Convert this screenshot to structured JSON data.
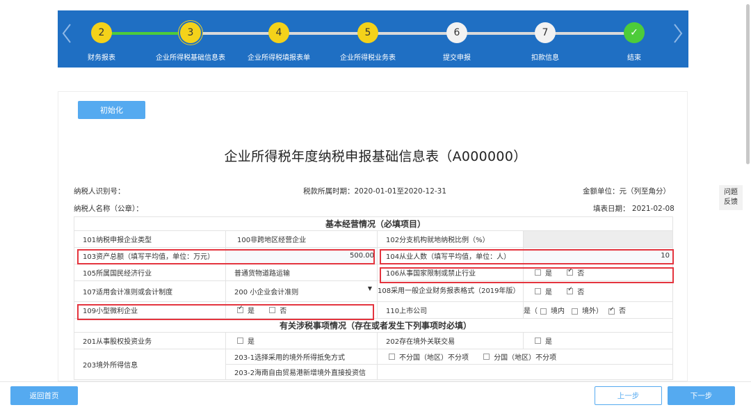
{
  "steps": [
    {
      "num": "2",
      "label": "财务报表"
    },
    {
      "num": "3",
      "label": "企业所得税基础信息表"
    },
    {
      "num": "4",
      "label": "企业所得税填报表单"
    },
    {
      "num": "5",
      "label": "企业所得税业务表"
    },
    {
      "num": "6",
      "label": "提交申报"
    },
    {
      "num": "7",
      "label": "扣款信息"
    },
    {
      "num": "✓",
      "label": "结束"
    }
  ],
  "init_button": "初始化",
  "form_title": "企业所得税年度纳税申报基础信息表（A000000）",
  "meta": {
    "taxpayer_id_label": "纳税人识别号：",
    "period": "税款所属时期：2020-01-01至2020-12-31",
    "unit": "金额单位：元（列至角分）",
    "taxpayer_name_label": "纳税人名称（公章）：",
    "fill_date": "填表日期： 2021-02-08"
  },
  "sections": {
    "basic": "基本经营情况（必填项目）",
    "tax_matters": "有关涉税事项情况（存在或者发生下列事项时必填）"
  },
  "rows": {
    "r101": {
      "label": "101纳税申报企业类型",
      "value": "100非跨地区经营企业"
    },
    "r102": {
      "label": "102分支机构就地纳税比例（%）"
    },
    "r103": {
      "label": "103资产总额（填写平均值，单位：万元）",
      "value": "500.00"
    },
    "r104": {
      "label": "104从业人数（填写平均值，单位：人）",
      "value": "10"
    },
    "r105": {
      "label": "105所属国民经济行业",
      "value": "普通货物道路运输"
    },
    "r106": {
      "label": "106从事国家限制或禁止行业"
    },
    "r107": {
      "label": "107适用会计准则或会计制度",
      "value": "200 小企业会计准则"
    },
    "r108": {
      "label": "108采用一般企业财务报表格式（2019年版）"
    },
    "r109": {
      "label": "109小型微利企业"
    },
    "r110": {
      "label": "110上市公司",
      "prefix": "是（",
      "domestic": "境内",
      "overseas": "境外）"
    },
    "r201": {
      "label": "201从事股权投资业务"
    },
    "r202": {
      "label": "202存在境外关联交易"
    },
    "r203": {
      "label": "203境外所得信息"
    },
    "r203_1": {
      "label": "203-1选择采用的境外所得抵免方式",
      "opt1": "不分国（地区）不分项",
      "opt2": "分国（地区）不分项"
    },
    "r203_2": {
      "label": "203-2海南自由贸易港新增境外直接投资信"
    }
  },
  "options": {
    "yes": "是",
    "no": "否"
  },
  "side": {
    "line1": "问题",
    "line2": "反馈"
  },
  "footer": {
    "home": "返回首页",
    "prev": "上一步",
    "next": "下一步"
  }
}
